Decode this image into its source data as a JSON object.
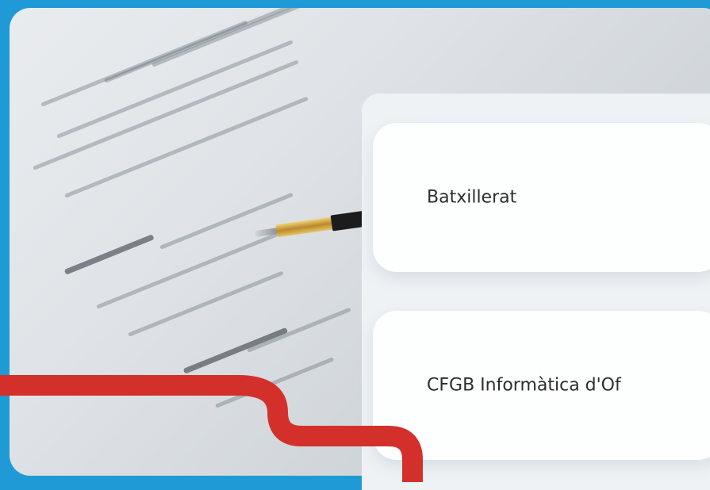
{
  "colors": {
    "background": "#1f9ad6",
    "ribbon": "#d3302c",
    "card": "#fdfefe",
    "panel": "#eef2f5",
    "text": "#2d2d2d"
  },
  "photo": {
    "subject": "document-with-pen"
  },
  "options": [
    {
      "label": "Batxillerat"
    },
    {
      "label": "CFGB Informàtica d'Of"
    }
  ]
}
